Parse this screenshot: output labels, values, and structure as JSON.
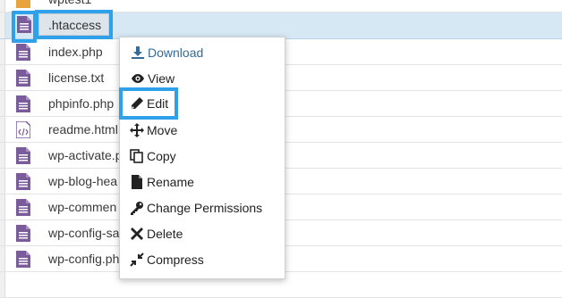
{
  "files": [
    {
      "name": "wptest1",
      "icon": "folder-icon"
    },
    {
      "name": ".htaccess",
      "icon": "file-icon",
      "selected": true
    },
    {
      "name": "index.php",
      "icon": "file-icon"
    },
    {
      "name": "license.txt",
      "icon": "file-icon"
    },
    {
      "name": "phpinfo.php",
      "icon": "file-icon"
    },
    {
      "name": "readme.html",
      "icon": "html-file-icon"
    },
    {
      "name": "wp-activate.p",
      "icon": "file-icon"
    },
    {
      "name": "wp-blog-hea",
      "icon": "file-icon"
    },
    {
      "name": "wp-commen",
      "icon": "file-icon"
    },
    {
      "name": "wp-config-sa",
      "icon": "file-icon"
    },
    {
      "name": "wp-config.ph",
      "icon": "file-icon"
    }
  ],
  "menu": {
    "items": [
      {
        "label": "Download",
        "icon": "download-icon"
      },
      {
        "label": "View",
        "icon": "eye-icon"
      },
      {
        "label": "Edit",
        "icon": "pencil-icon"
      },
      {
        "label": "Move",
        "icon": "move-arrows-icon"
      },
      {
        "label": "Copy",
        "icon": "copy-icon"
      },
      {
        "label": "Rename",
        "icon": "file-icon"
      },
      {
        "label": "Change Permissions",
        "icon": "key-icon"
      },
      {
        "label": "Delete",
        "icon": "x-icon"
      },
      {
        "label": "Compress",
        "icon": "compress-icon"
      }
    ]
  },
  "colors": {
    "highlight": "#2fa1ea",
    "file_icon": "#7a5c9a",
    "selected_row": "#d7e8f5",
    "download_text": "#336b99"
  }
}
